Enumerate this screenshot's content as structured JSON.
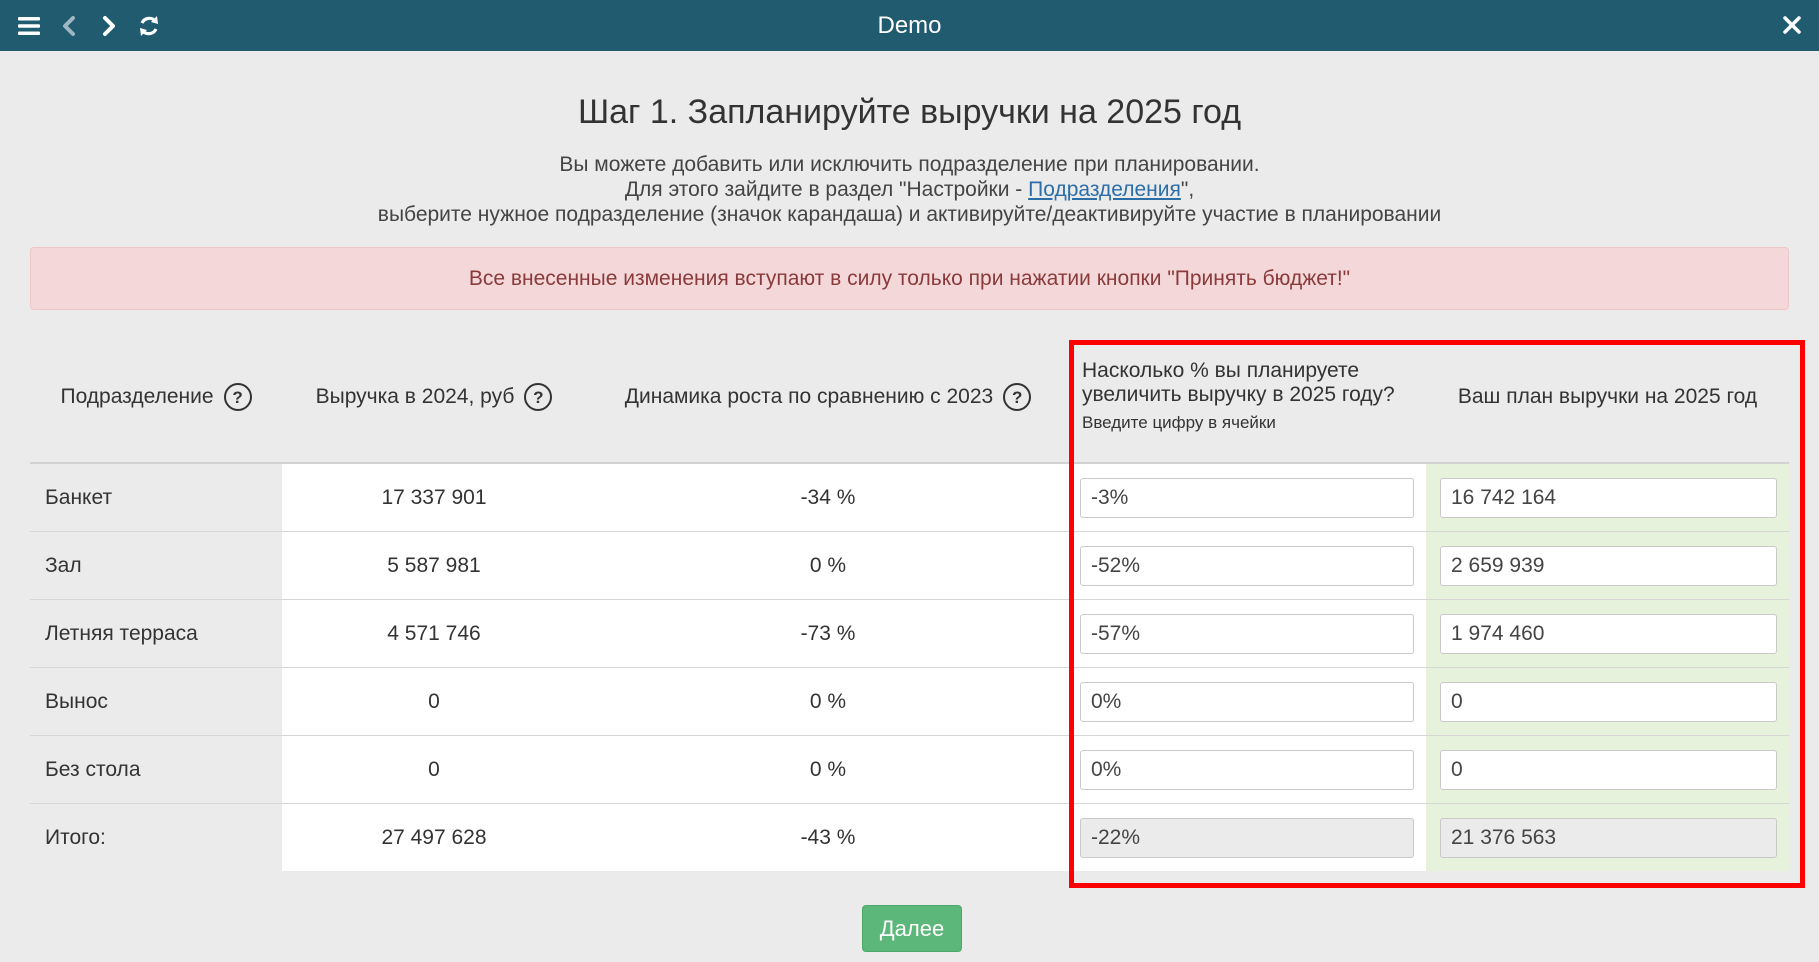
{
  "window": {
    "title": "Demo"
  },
  "icons": {
    "menu": "menu-icon",
    "back": "chevron-left-icon",
    "forward": "chevron-right-icon",
    "refresh": "refresh-icon",
    "close": "close-icon"
  },
  "page": {
    "heading": "Шаг 1. Запланируйте выручки на 2025 год",
    "desc_line1": "Вы можете добавить или исключить подразделение при планировании.",
    "desc_line2_pre": "Для этого зайдите в раздел \"Настройки - ",
    "desc_line2_link": "Подразделения",
    "desc_line2_post": "\",",
    "desc_line3": "выберите нужное подразделение (значок карандаша) и активируйте/деактивируйте участие в планировании",
    "alert": "Все внесенные изменения вступают в силу только при нажатии кнопки \"Принять бюджет!\""
  },
  "table": {
    "headers": {
      "division": "Подразделение",
      "revenue": "Выручка в 2024, руб",
      "dynamics": "Динамика роста по сравнению с 2023",
      "plan_pct": "Насколько % вы планируете увеличить выручку в 2025 году?",
      "plan_pct_hint": "Введите цифру в ячейки",
      "plan": "Ваш план выручки на 2025 год",
      "help_glyph": "?"
    },
    "rows": [
      {
        "name": "Банкет",
        "revenue": "17 337 901",
        "dynamics": "-34 %",
        "pct": "-3%",
        "plan": "16 742 164"
      },
      {
        "name": "Зал",
        "revenue": "5 587 981",
        "dynamics": "0 %",
        "pct": "-52%",
        "plan": "2 659 939"
      },
      {
        "name": "Летняя терраса",
        "revenue": "4 571 746",
        "dynamics": "-73 %",
        "pct": "-57%",
        "plan": "1 974 460"
      },
      {
        "name": "Вынос",
        "revenue": "0",
        "dynamics": "0 %",
        "pct": "0%",
        "plan": "0"
      },
      {
        "name": "Без стола",
        "revenue": "0",
        "dynamics": "0 %",
        "pct": "0%",
        "plan": "0"
      }
    ],
    "total": {
      "name": "Итого:",
      "revenue": "27 497 628",
      "dynamics": "-43 %",
      "pct": "-22%",
      "plan": "21 376 563"
    }
  },
  "buttons": {
    "next": "Далее"
  },
  "colors": {
    "header": "#215b6f",
    "highlight": "#ff0000",
    "next": "#5cb87a",
    "plan_bg": "#e6f2dc",
    "alert_bg": "#f4d8d9"
  }
}
